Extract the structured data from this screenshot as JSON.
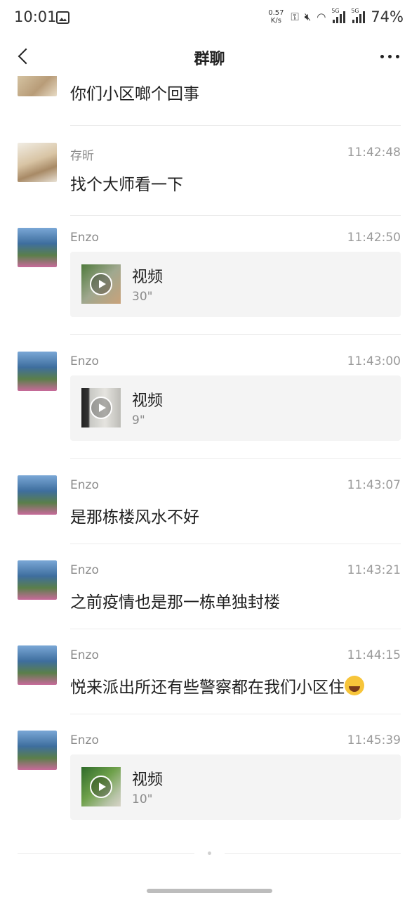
{
  "status_bar": {
    "time": "10:01",
    "net_speed_value": "0.57",
    "net_speed_unit": "K/s",
    "signal1_label": "5G",
    "signal2_label": "5G",
    "battery": "74%"
  },
  "header": {
    "title": "群聊"
  },
  "messages": [
    {
      "text": "你们小区啷个回事"
    },
    {
      "sender": "存昕",
      "time": "11:42:48",
      "text": "找个大师看一下"
    },
    {
      "sender": "Enzo",
      "time": "11:42:50",
      "video_label": "视频",
      "duration": "30\""
    },
    {
      "sender": "Enzo",
      "time": "11:43:00",
      "video_label": "视频",
      "duration": "9\""
    },
    {
      "sender": "Enzo",
      "time": "11:43:07",
      "text": "是那栋楼风水不好"
    },
    {
      "sender": "Enzo",
      "time": "11:43:21",
      "text": "之前疫情也是那一栋单独封楼"
    },
    {
      "sender": "Enzo",
      "time": "11:44:15",
      "text": "悦来派出所还有些警察都在我们小区住"
    },
    {
      "sender": "Enzo",
      "time": "11:45:39",
      "video_label": "视频",
      "duration": "10\""
    }
  ],
  "icons": {
    "back": "back-arrow-icon",
    "more": "more-dots-icon",
    "emoji": "laughing-tears-emoji",
    "play": "play-icon"
  }
}
